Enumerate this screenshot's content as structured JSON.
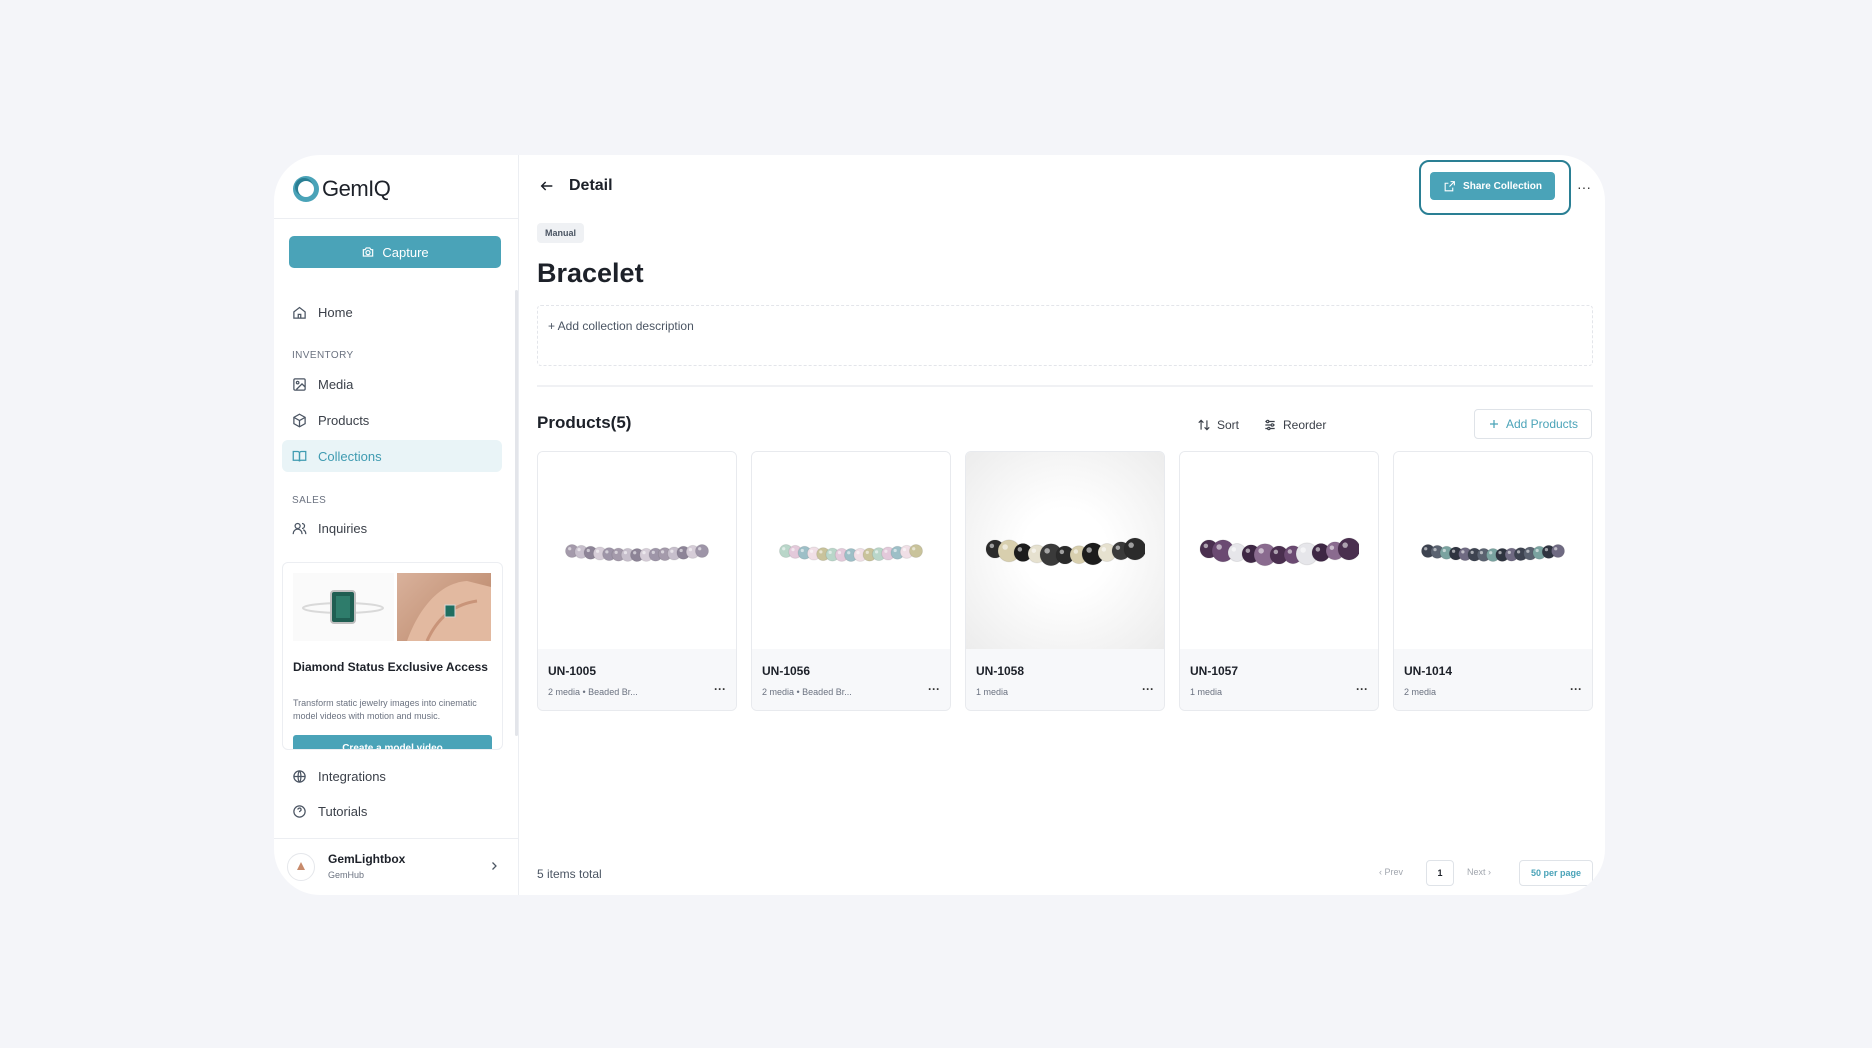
{
  "app": {
    "name": "GemIQ"
  },
  "sidebar": {
    "capture_label": "Capture",
    "home_label": "Home",
    "inventory_label": "INVENTORY",
    "media_label": "Media",
    "products_label": "Products",
    "collections_label": "Collections",
    "sales_label": "SALES",
    "inquiries_label": "Inquiries",
    "integrations_label": "Integrations",
    "tutorials_label": "Tutorials",
    "promo": {
      "title": "Diamond Status Exclusive Access",
      "description": "Transform static jewelry images into cinematic model videos with motion and music.",
      "button": "Create a model video"
    },
    "user": {
      "name": "GemLightbox",
      "org": "GemHub"
    }
  },
  "header": {
    "title": "Detail",
    "share_label": "Share Collection",
    "more_label": "···"
  },
  "collection": {
    "badge": "Manual",
    "title": "Bracelet",
    "description_placeholder": "+ Add collection description"
  },
  "products": {
    "title": "Products(5)",
    "sort_label": "Sort",
    "reorder_label": "Reorder",
    "add_label": "Add Products",
    "items": [
      {
        "sku": "UN-1005",
        "meta": "2 media  •  Beaded Br...",
        "more": "···"
      },
      {
        "sku": "UN-1056",
        "meta": "2 media  •  Beaded Br...",
        "more": "···"
      },
      {
        "sku": "UN-1058",
        "meta": "1 media",
        "more": "···"
      },
      {
        "sku": "UN-1057",
        "meta": "1 media",
        "more": "···"
      },
      {
        "sku": "UN-1014",
        "meta": "2 media",
        "more": "···"
      }
    ]
  },
  "pagination": {
    "total": "5 items total",
    "prev": "‹ Prev",
    "page": "1",
    "next": "Next ›",
    "per_page": "50 per page"
  },
  "colors": {
    "accent": "#4aa3b8",
    "accent_dark": "#2a7f94",
    "active_bg": "#e9f4f7"
  }
}
